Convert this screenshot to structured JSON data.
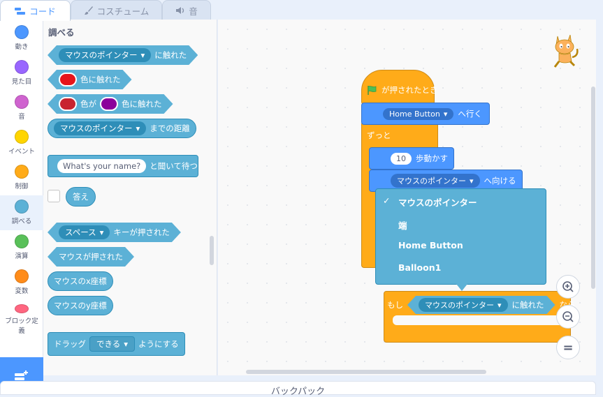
{
  "tabs": [
    {
      "label": "コード",
      "icon": "code-icon"
    },
    {
      "label": "コスチューム",
      "icon": "brush-icon"
    },
    {
      "label": "音",
      "icon": "speaker-icon"
    }
  ],
  "categories": [
    {
      "label": "動き",
      "color": "#4c97ff"
    },
    {
      "label": "見た目",
      "color": "#9966ff"
    },
    {
      "label": "音",
      "color": "#cf63cf"
    },
    {
      "label": "イベント",
      "color": "#ffd500"
    },
    {
      "label": "制御",
      "color": "#ffab19"
    },
    {
      "label": "調べる",
      "color": "#5cb1d6"
    },
    {
      "label": "演算",
      "color": "#59c059"
    },
    {
      "label": "変数",
      "color": "#ff8c1a"
    },
    {
      "label": "ブロック定義",
      "color": "#ff6680"
    }
  ],
  "palette": {
    "heading": "調べる",
    "touching": {
      "menu": "マウスのポインター",
      "suffix": "に触れた"
    },
    "touching_color": {
      "suffix": "色に触れた",
      "color": "#e6141b"
    },
    "color_touching": {
      "mid": "色が",
      "suffix": "色に触れた",
      "color1": "#c8242f",
      "color2": "#8b009b"
    },
    "distance": {
      "menu": "マウスのポインター",
      "suffix": "までの距離"
    },
    "ask": {
      "input": "What's your name?",
      "suffix": "と聞いて待つ"
    },
    "answer": "答え",
    "keypressed": {
      "menu": "スペース",
      "suffix": "キーが押された"
    },
    "mousedown": "マウスが押された",
    "mousex": "マウスのx座標",
    "mousey": "マウスのy座標",
    "draggable": {
      "prefix": "ドラッグ",
      "menu": "できる",
      "suffix": "ようにする"
    }
  },
  "script": {
    "hat": "が押されたとき",
    "goto": {
      "menu": "Home Button",
      "suffix": "へ行く"
    },
    "forever": "ずっと",
    "move": {
      "value": "10",
      "suffix": "歩動かす"
    },
    "pointto": {
      "menu": "マウスのポインター",
      "suffix": "へ向ける"
    },
    "ifblock": {
      "prefix": "もし",
      "menu": "マウスのポインター",
      "mid": "に触れた",
      "suffix": "なら"
    }
  },
  "dropdown": {
    "items": [
      "マウスのポインター",
      "端",
      "Home Button",
      "Balloon1"
    ],
    "selected_index": 0,
    "check": "✓"
  },
  "zoom": {
    "in": "zoom-in-icon",
    "out": "zoom-out-icon",
    "reset": "="
  },
  "backpack": "バックパック"
}
